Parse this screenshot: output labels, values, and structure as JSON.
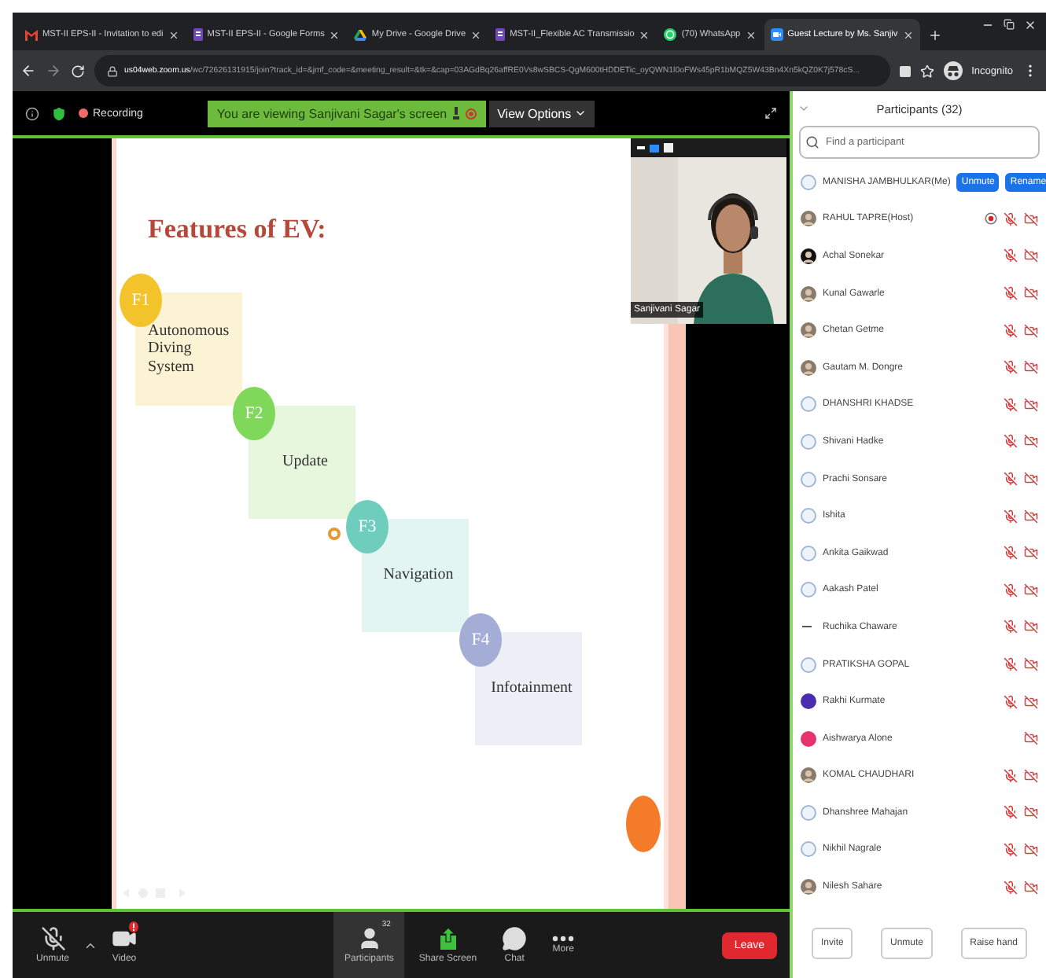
{
  "browser": {
    "tabs": [
      {
        "title": "MST-II EPS-II - Invitation to edi",
        "selected": false
      },
      {
        "title": "MST-II EPS-II - Google Forms",
        "selected": false
      },
      {
        "title": "My Drive - Google Drive",
        "selected": false
      },
      {
        "title": "MST-II_Flexible AC Transmissio",
        "selected": false
      },
      {
        "title": "(70) WhatsApp",
        "selected": false
      },
      {
        "title": "Guest Lecture by Ms. Sanjiv",
        "selected": true
      }
    ],
    "address": {
      "host": "us04web.zoom.us",
      "path": "/wc/72626131915/join?track_id=&jmf_code=&meeting_result=&tk=&cap=03AGdBq26affRE0Vs8wSBCS-QgM600tHDDETic_oyQWN1l0oFWs45pR1bMQZ5W43Bn4Xn5kQZ0K7j578cS..."
    },
    "profile": "Incognito"
  },
  "meeting": {
    "recording": "Recording",
    "banner": "You are viewing Sanjivani Sagar's screen",
    "view_options": "View Options",
    "slide": {
      "title": "Features of EV:",
      "features": [
        {
          "badge": "F1",
          "label": "Autonomous Diving System",
          "color": "#f2c32a"
        },
        {
          "badge": "F2",
          "label": "Update",
          "color": "#80d85a"
        },
        {
          "badge": "F3",
          "label": "Navigation",
          "color": "#6ecdbd"
        },
        {
          "badge": "F4",
          "label": "Infotainment",
          "color": "#a4add5"
        }
      ]
    },
    "video": {
      "name": "Sanjivani Sagar"
    },
    "toolbar": {
      "left": [
        "Unmute",
        "Video"
      ],
      "center": [
        {
          "label": "Participants",
          "count": "32",
          "selected": true
        },
        {
          "label": "Share Screen",
          "selected": false
        },
        {
          "label": "Chat",
          "selected": false
        },
        {
          "label": "More",
          "selected": false
        }
      ],
      "leave": "Leave"
    }
  },
  "participants": {
    "title": "Participants (32)",
    "search": {
      "placeholder": "Find a participant"
    },
    "list": [
      {
        "name": "MANISHA JAMBHULKAR(Me)",
        "kind": "default",
        "muted": false,
        "video_off": false,
        "recording": false,
        "actions": [
          "Unmute",
          "Rename"
        ]
      },
      {
        "name": "RAHUL TAPRE(Host)",
        "muted": true,
        "video_off": true,
        "recording": true
      },
      {
        "name": "Achal Sonekar",
        "muted": true,
        "video_off": true,
        "recording": false
      },
      {
        "name": "Kunal Gawarle",
        "muted": true,
        "video_off": true,
        "recording": false
      },
      {
        "name": "Chetan Getme",
        "muted": true,
        "video_off": true,
        "recording": false
      },
      {
        "name": "Gautam M. Dongre",
        "muted": true,
        "video_off": true,
        "recording": false
      },
      {
        "name": "DHANSHRI KHADSE",
        "kind": "default",
        "muted": true,
        "video_off": true,
        "recording": false
      },
      {
        "name": "Shivani Hadke",
        "kind": "default",
        "muted": true,
        "video_off": true,
        "recording": false
      },
      {
        "name": "Prachi Sonsare",
        "kind": "default",
        "muted": true,
        "video_off": true,
        "recording": false
      },
      {
        "name": "Ishita",
        "kind": "default",
        "muted": true,
        "video_off": true,
        "recording": false
      },
      {
        "name": "Ankita Gaikwad",
        "kind": "default",
        "muted": true,
        "video_off": true,
        "recording": false
      },
      {
        "name": "Aakash Patel",
        "kind": "default",
        "muted": true,
        "video_off": true,
        "recording": false
      },
      {
        "name": "Ruchika Chaware",
        "kind": "dash",
        "muted": true,
        "video_off": true,
        "recording": false
      },
      {
        "name": "PRATIKSHA GOPAL",
        "kind": "default",
        "muted": true,
        "video_off": true,
        "recording": false
      },
      {
        "name": "Rakhi Kurmate",
        "kind": "color",
        "color": "#4b2bb0",
        "muted": true,
        "video_off": true,
        "recording": false
      },
      {
        "name": "Aishwarya Alone",
        "kind": "color",
        "color": "#e5336b",
        "muted": false,
        "video_off": true,
        "recording": false
      },
      {
        "name": "KOMAL CHAUDHARI",
        "muted": true,
        "video_off": true,
        "recording": false
      },
      {
        "name": "Dhanshree Mahajan",
        "kind": "default",
        "muted": true,
        "video_off": true,
        "recording": false
      },
      {
        "name": "Nikhil Nagrale",
        "kind": "default",
        "muted": true,
        "video_off": true,
        "recording": false
      },
      {
        "name": "Nilesh Sahare",
        "muted": true,
        "video_off": true,
        "recording": false
      }
    ],
    "buttons": [
      "Invite",
      "Unmute",
      "Raise hand"
    ]
  }
}
